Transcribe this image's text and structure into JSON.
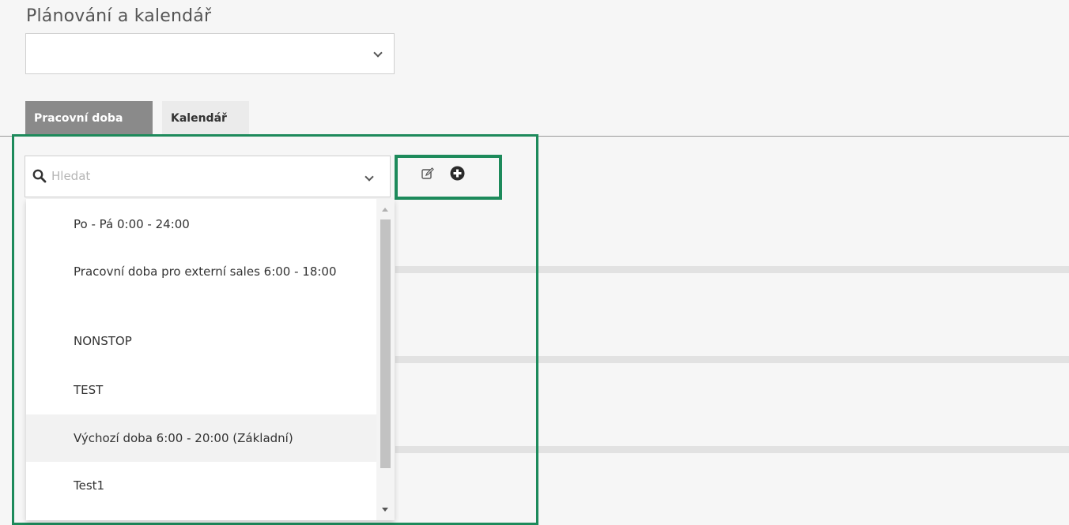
{
  "page": {
    "title": "Plánování a kalendář"
  },
  "top_select": {
    "value": ""
  },
  "tabs": [
    {
      "label": "Pracovní doba",
      "active": true
    },
    {
      "label": "Kalendář",
      "active": false
    }
  ],
  "search": {
    "placeholder": "Hledat"
  },
  "toolbar": {
    "edit_icon": "edit-icon",
    "add_icon": "plus-circle-icon"
  },
  "dropdown": {
    "items": [
      {
        "label": "Po - Pá 0:00 - 24:00"
      },
      {
        "label": "Pracovní doba pro externí sales 6:00 - 18:00"
      },
      {
        "label": "NONSTOP"
      },
      {
        "label": "TEST"
      },
      {
        "label": "Výchozí doba 6:00 - 20:00 (Základní)",
        "highlighted": true
      },
      {
        "label": "Test1"
      }
    ]
  },
  "colors": {
    "highlight_border": "#1d8a5b",
    "active_tab_bg": "#8a8a8a"
  }
}
